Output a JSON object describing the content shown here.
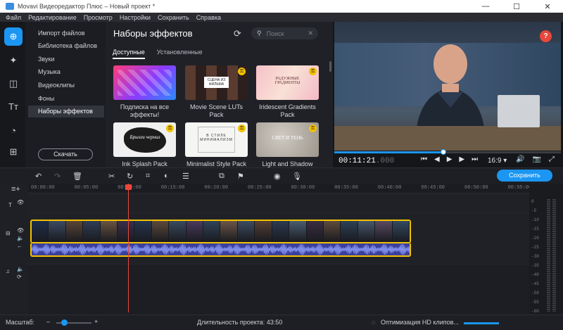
{
  "window": {
    "title": "Movavi Видеоредактор Плюс – Новый проект *",
    "controls": [
      "—",
      "☐",
      "✕"
    ]
  },
  "menu": [
    "Файл",
    "Редактирование",
    "Просмотр",
    "Настройки",
    "Сохранить",
    "Справка"
  ],
  "sidenav": {
    "items": [
      "Импорт файлов",
      "Библиотека файлов",
      "Звуки",
      "Музыка",
      "Видеоклипы",
      "Фоны",
      "Наборы эффектов"
    ],
    "selected": "Наборы эффектов",
    "download_label": "Скачать"
  },
  "effects_panel": {
    "title": "Наборы эффектов",
    "search_placeholder": "Поиск",
    "tabs": [
      "Доступные",
      "Установленные"
    ],
    "active_tab": "Доступные",
    "cards": [
      {
        "caption": "Подписка на все эффекты!",
        "thumb_text": "",
        "premium": false
      },
      {
        "caption": "Movie Scene LUTs Pack",
        "thumb_text": "СЦЕНА ИЗ ФИЛЬМА",
        "premium": true
      },
      {
        "caption": "Iridescent Gradients Pack",
        "thumb_text": "РАДУЖНЫЕ ГРАДИЕНТЫ",
        "premium": true
      },
      {
        "caption": "Ink Splash Pack",
        "thumb_text": "Брызги чернил",
        "premium": true
      },
      {
        "caption": "Minimalist Style Pack",
        "thumb_text": "В СТИЛЕ МИНИМАЛИЗМ",
        "premium": true
      },
      {
        "caption": "Light and Shadow",
        "thumb_text": "СВЕТ И ТЕНЬ",
        "premium": true
      }
    ]
  },
  "preview": {
    "timecode_main": "00:11:21",
    "timecode_ms": ".000",
    "progress": 0.48,
    "aspect_ratio": "16:9",
    "help_label": "?"
  },
  "timeline": {
    "save_label": "Сохранить",
    "ruler_ticks": [
      "00:00:00",
      "00:05:00",
      "00:10:00",
      "00:15:00",
      "00:20:00",
      "00:25:00",
      "00:30:00",
      "00:35:00",
      "00:40:00",
      "00:45:00",
      "00:50:00",
      "00:55:00"
    ],
    "vu_scale": [
      "0",
      "-5",
      "-10",
      "-15",
      "-20",
      "-25",
      "-30",
      "-35",
      "-40",
      "-45",
      "-50",
      "-55",
      "-60"
    ]
  },
  "status": {
    "zoom_label": "Масштаб:",
    "duration_label": "Длительность проекта: 43:50",
    "optimize_label": "Оптимизация HD клипов..."
  },
  "colors": {
    "accent": "#1b96f3",
    "clip_border": "#f2c200",
    "playhead": "#e8483b",
    "audio": "#3b3f9a"
  }
}
